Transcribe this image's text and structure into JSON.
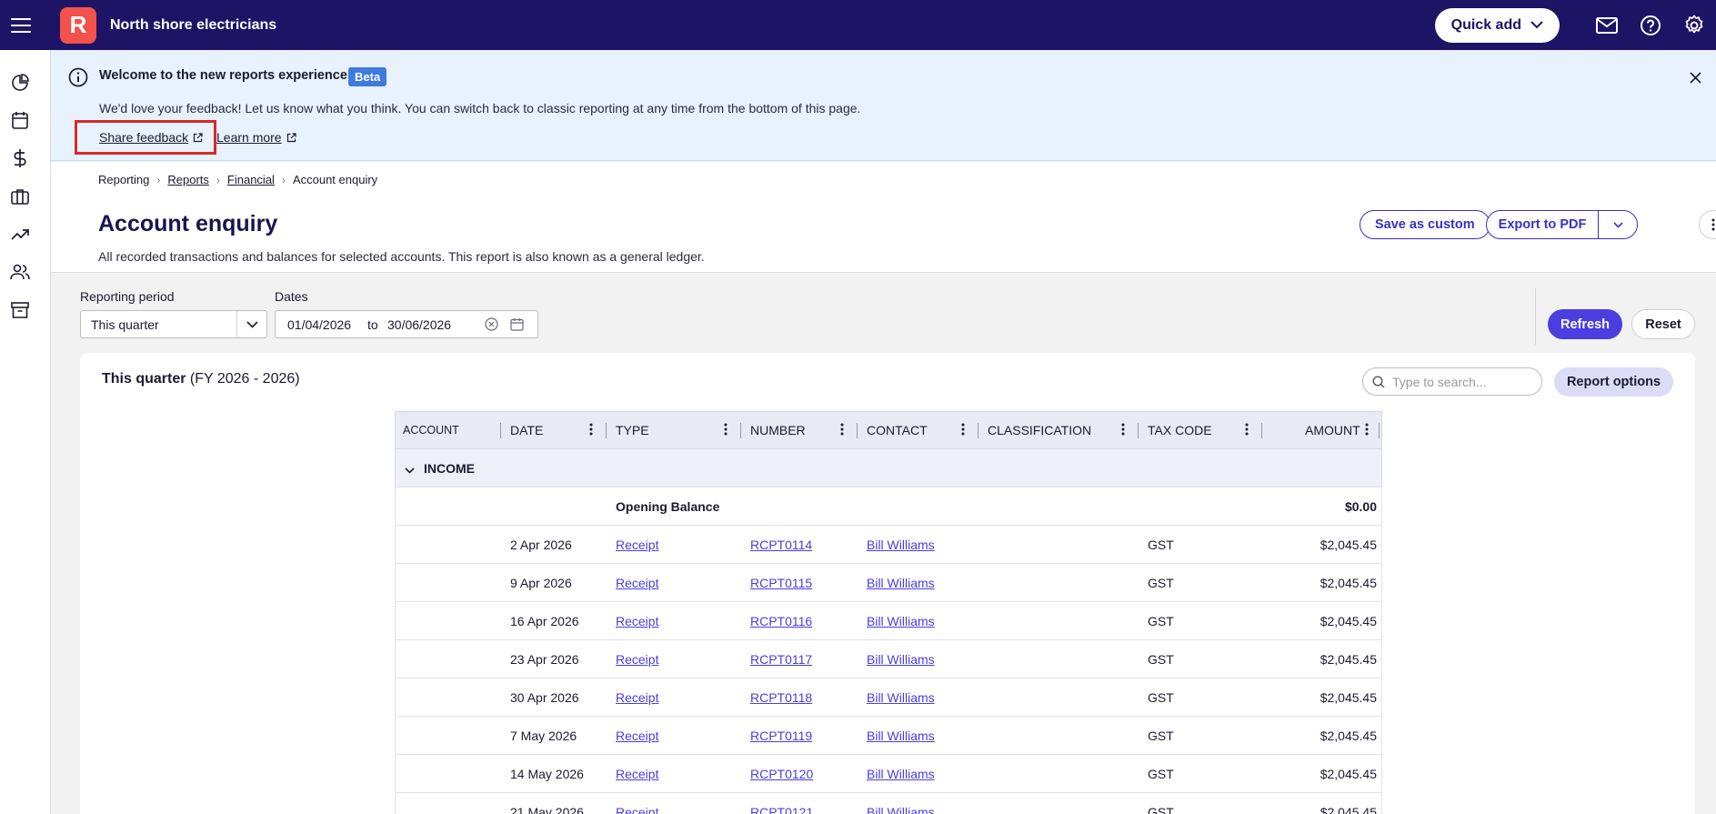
{
  "topbar": {
    "logo_letter": "R",
    "company_name": "North shore electricians",
    "quick_add_label": "Quick add"
  },
  "banner": {
    "title": "Welcome to the new reports experience",
    "badge": "Beta",
    "text": "We'd love your feedback! Let us know what you think. You can switch back to classic reporting at any time from the bottom of this page.",
    "share_feedback": "Share feedback",
    "learn_more": "Learn more"
  },
  "breadcrumb": {
    "items": [
      "Reporting",
      "Reports",
      "Financial",
      "Account enquiry"
    ]
  },
  "page": {
    "title": "Account enquiry",
    "description": "All recorded transactions and balances for selected accounts. This report is also known as a general ledger.",
    "save_custom": "Save as custom",
    "export_pdf": "Export to PDF"
  },
  "filters": {
    "period_label": "Reporting period",
    "period_value": "This quarter",
    "dates_label": "Dates",
    "date_from": "01/04/2026",
    "date_to_label": "to",
    "date_to": "30/06/2026",
    "refresh": "Refresh",
    "reset": "Reset"
  },
  "report": {
    "period_title": "This quarter",
    "period_sub": "(FY 2026 - 2026)",
    "search_placeholder": "Type to search...",
    "report_options": "Report options",
    "columns": [
      "ACCOUNT",
      "DATE",
      "TYPE",
      "NUMBER",
      "CONTACT",
      "CLASSIFICATION",
      "TAX CODE",
      "AMOUNT"
    ],
    "group_label": "INCOME",
    "opening_label": "Opening Balance",
    "opening_amount": "$0.00",
    "rows": [
      {
        "date": "2 Apr 2026",
        "type": "Receipt",
        "number": "RCPT0114",
        "contact": "Bill Williams",
        "tax": "GST",
        "amount": "$2,045.45"
      },
      {
        "date": "9 Apr 2026",
        "type": "Receipt",
        "number": "RCPT0115",
        "contact": "Bill Williams",
        "tax": "GST",
        "amount": "$2,045.45"
      },
      {
        "date": "16 Apr 2026",
        "type": "Receipt",
        "number": "RCPT0116",
        "contact": "Bill Williams",
        "tax": "GST",
        "amount": "$2,045.45"
      },
      {
        "date": "23 Apr 2026",
        "type": "Receipt",
        "number": "RCPT0117",
        "contact": "Bill Williams",
        "tax": "GST",
        "amount": "$2,045.45"
      },
      {
        "date": "30 Apr 2026",
        "type": "Receipt",
        "number": "RCPT0118",
        "contact": "Bill Williams",
        "tax": "GST",
        "amount": "$2,045.45"
      },
      {
        "date": "7 May 2026",
        "type": "Receipt",
        "number": "RCPT0119",
        "contact": "Bill Williams",
        "tax": "GST",
        "amount": "$2,045.45"
      },
      {
        "date": "14 May 2026",
        "type": "Receipt",
        "number": "RCPT0120",
        "contact": "Bill Williams",
        "tax": "GST",
        "amount": "$2,045.45"
      },
      {
        "date": "21 May 2026",
        "type": "Receipt",
        "number": "RCPT0121",
        "contact": "Bill Williams",
        "tax": "GST",
        "amount": "$2,045.45"
      }
    ]
  }
}
